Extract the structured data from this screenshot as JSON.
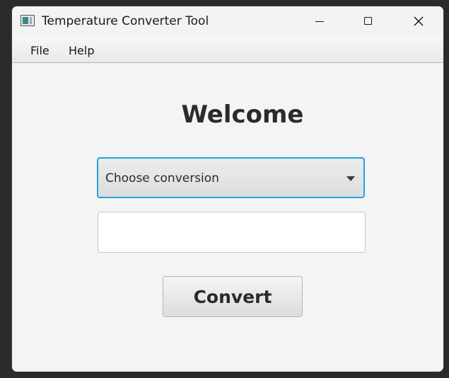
{
  "window": {
    "title": "Temperature Converter Tool"
  },
  "menu": {
    "items": [
      {
        "label": "File"
      },
      {
        "label": "Help"
      }
    ]
  },
  "main": {
    "heading": "Welcome",
    "conversion_select": {
      "selected_value": "Choose conversion"
    },
    "input": {
      "value": "",
      "placeholder": ""
    },
    "convert_label": "Convert"
  },
  "colors": {
    "focus_border": "#2ca3d6",
    "window_background": "#f4f4f4",
    "heading_text": "#2b2b2b"
  }
}
